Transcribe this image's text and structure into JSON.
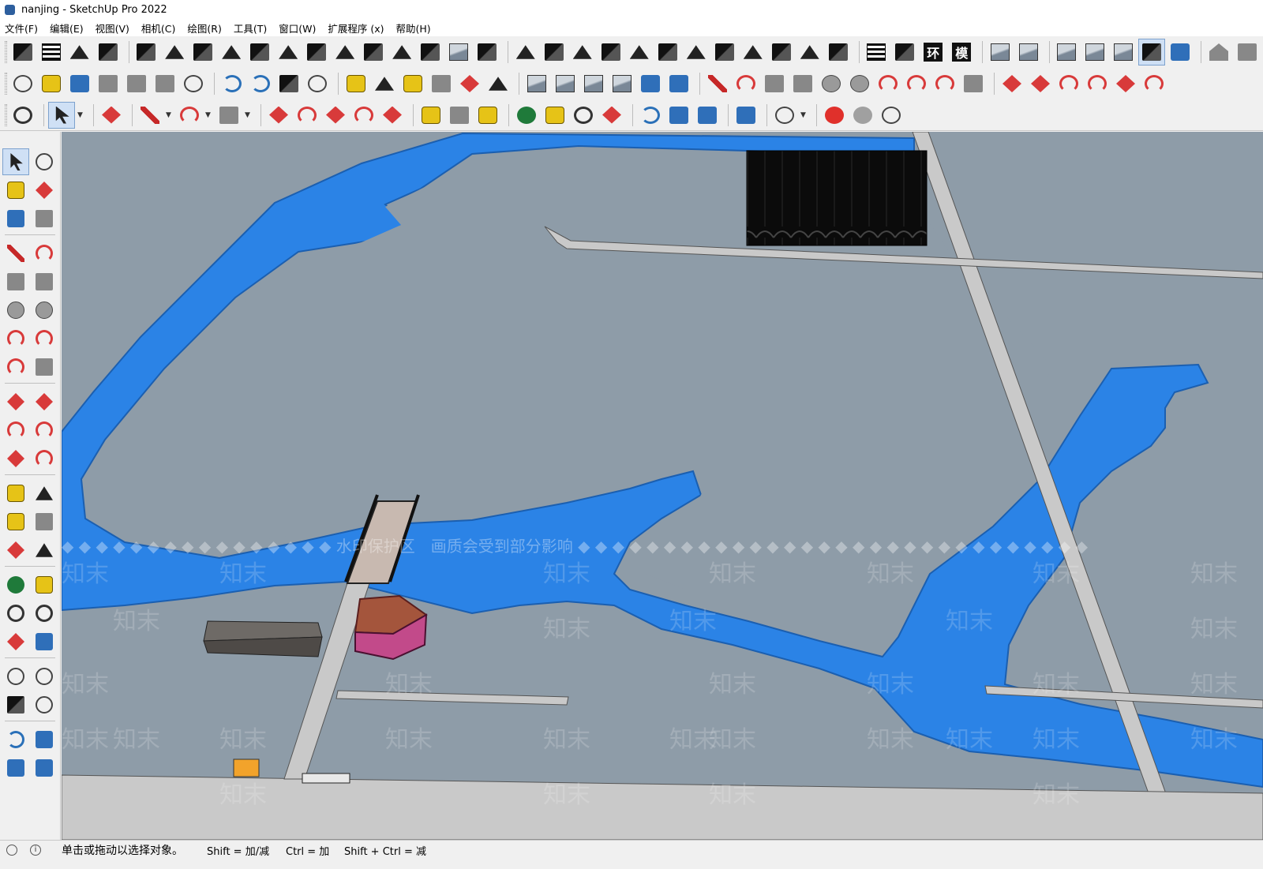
{
  "window": {
    "title": "nanjing - SketchUp Pro 2022"
  },
  "menu": [
    "文件(F)",
    "编辑(E)",
    "视图(V)",
    "相机(C)",
    "绘图(R)",
    "工具(T)",
    "窗口(W)",
    "扩展程序 (x)",
    "帮助(H)"
  ],
  "toolbar_text_buttons": {
    "huan": "环",
    "mo": "模"
  },
  "viewport": {
    "colors": {
      "ground": "#8e9ca8",
      "water": "#2b83e6",
      "water_bank": "#1b5fb0",
      "road": "#c9c9c9"
    },
    "watermark": {
      "banner": "◆ ◆ ◆ ◆ ◆ ◆ ◆ ◆ ◆ ◆ ◆ ◆ ◆ ◆ ◆ ◆ 水印保护区　画质会受到部分影响 ◆ ◆ ◆ ◆ ◆ ◆ ◆ ◆ ◆ ◆ ◆ ◆ ◆ ◆ ◆ ◆ ◆ ◆ ◆ ◆ ◆ ◆ ◆ ◆ ◆ ◆ ◆ ◆ ◆ ◆",
      "tile_text": "知末"
    }
  },
  "statusbar": {
    "main_text": "单击或拖动以选择对象。",
    "hint_shift": "Shift = 加/减",
    "hint_ctrl": "Ctrl = 加",
    "hint_shift_ctrl": "Shift + Ctrl = 减",
    "info_icon": "i"
  }
}
